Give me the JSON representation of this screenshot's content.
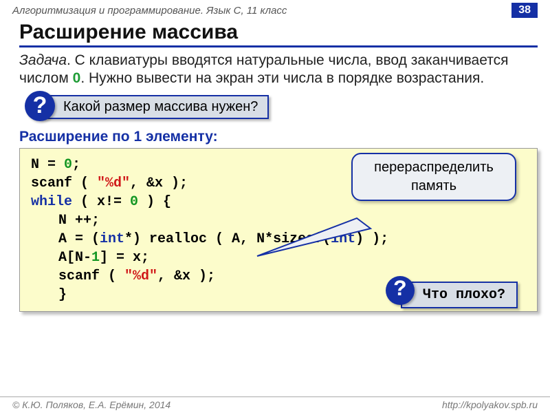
{
  "header": {
    "course": "Алгоритмизация и программирование. Язык С, 11 класс",
    "page": "38"
  },
  "title": "Расширение массива",
  "task": {
    "label": "Задача",
    "text_before_zero": ". С клавиатуры вводятся натуральные числа, ввод заканчивается числом ",
    "zero": "0",
    "text_after_zero": ". Нужно вывести на экран эти числа в порядке возрастания."
  },
  "question1": {
    "mark": "?",
    "text": "Какой размер массива нужен?"
  },
  "subhead": "Расширение по 1 элементу:",
  "code": {
    "l1a": "N = ",
    "l1n": "0",
    "l1b": ";",
    "l2a": "scanf ( ",
    "l2s": "\"%d\"",
    "l2b": ", &x );",
    "l3a": "while",
    "l3b": " ( x!= ",
    "l3n": "0",
    "l3c": " ) {",
    "l4": "N ++;",
    "l5a": "A = (",
    "l5k1": "int",
    "l5b": "*) realloc ( A, N*sizeof(",
    "l5k2": "int",
    "l5c": ") );",
    "l6a": "A[N-",
    "l6n": "1",
    "l6b": "] = x;",
    "l7a": "scanf ( ",
    "l7s": "\"%d\"",
    "l7b": ", &x );",
    "l8": "}"
  },
  "callout1": "перераспределить память",
  "question2": {
    "mark": "?",
    "text": "Что плохо?"
  },
  "footer": {
    "left": "© К.Ю. Поляков, Е.А. Ерёмин, 2014",
    "right": "http://kpolyakov.spb.ru"
  }
}
